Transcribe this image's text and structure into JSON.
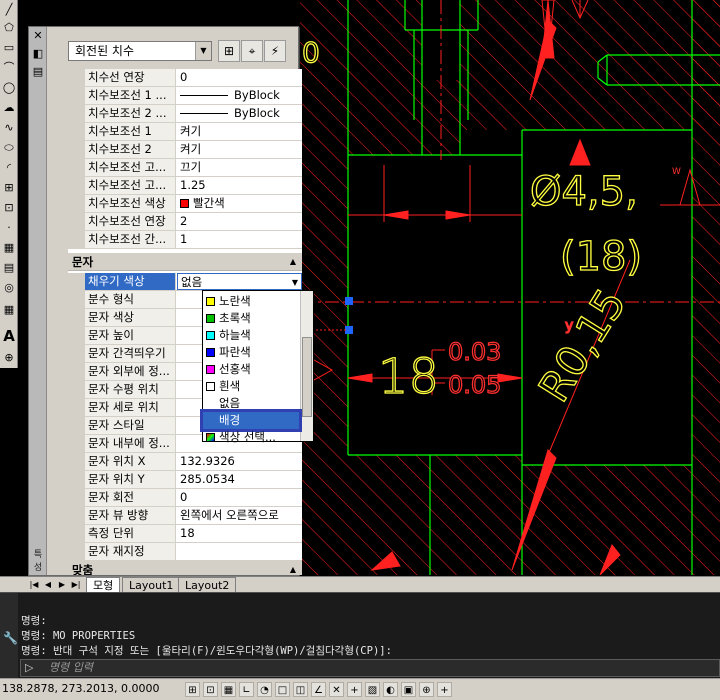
{
  "toolbar": {
    "icons": [
      "line-icon",
      "polygon-icon",
      "rectangle-icon",
      "arc-icon",
      "circle-icon",
      "revision-cloud-icon",
      "spline-icon",
      "ellipse-icon",
      "ellipse-arc-icon",
      "insert-block-icon",
      "make-block-icon",
      "point-icon",
      "hatch-icon",
      "gradient-icon",
      "region-icon",
      "table-icon",
      "mtext-icon"
    ],
    "mtext_glyph": "A"
  },
  "palette": {
    "object_type": "회전된 치수",
    "close_glyph": "✕",
    "buttons": [
      "toggle-pickadd-icon",
      "select-objects-icon",
      "quick-select-icon"
    ],
    "rows_top": [
      {
        "name": "치수선 연장",
        "value": "0"
      },
      {
        "name": "치수보조선 1 ...",
        "value": "ByBlock",
        "linetype": true
      },
      {
        "name": "치수보조선 2 ...",
        "value": "ByBlock",
        "linetype": true
      },
      {
        "name": "치수보조선 1",
        "value": "켜기"
      },
      {
        "name": "치수보조선 2",
        "value": "켜기"
      },
      {
        "name": "치수보조선 고...",
        "value": "끄기"
      },
      {
        "name": "치수보조선 고...",
        "value": "1.25"
      },
      {
        "name": "치수보조선 색상",
        "value": "빨간색",
        "swatch": "#ff0000"
      },
      {
        "name": "치수보조선 연장",
        "value": "2"
      },
      {
        "name": "치수보조선 간...",
        "value": "1"
      }
    ],
    "section_text": "문자",
    "rows_text": [
      {
        "name": "채우기 색상",
        "value": "없음",
        "active": true
      },
      {
        "name": "분수 형식",
        "value": ""
      },
      {
        "name": "문자 색상",
        "value": ""
      },
      {
        "name": "문자 높이",
        "value": ""
      },
      {
        "name": "문자 간격띄우기",
        "value": ""
      },
      {
        "name": "문자 외부에 정...",
        "value": ""
      },
      {
        "name": "문자 수평 위치",
        "value": ""
      },
      {
        "name": "문자 세로 위치",
        "value": ""
      },
      {
        "name": "문자 스타일",
        "value": ""
      },
      {
        "name": "문자 내부에 정...",
        "value": ""
      },
      {
        "name": "문자 위치 X",
        "value": "132.9326"
      },
      {
        "name": "문자 위치 Y",
        "value": "285.0534"
      },
      {
        "name": "문자 회전",
        "value": "0"
      },
      {
        "name": "문자 뷰 방향",
        "value": "왼쪽에서 오른쪽으로"
      },
      {
        "name": "측정 단위",
        "value": "18"
      },
      {
        "name": "문자 재지정",
        "value": ""
      }
    ],
    "section_last": "맞춤",
    "dropdown": [
      {
        "label": "노란색",
        "swatch": "#ffff00"
      },
      {
        "label": "초록색",
        "swatch": "#00c000"
      },
      {
        "label": "하늘색",
        "swatch": "#00ffff"
      },
      {
        "label": "파란색",
        "swatch": "#0000ff"
      },
      {
        "label": "선홍색",
        "swatch": "#ff00ff"
      },
      {
        "label": "흰색",
        "swatch": "#ffffff"
      },
      {
        "label": "없음",
        "swatch": ""
      },
      {
        "label": "배경",
        "swatch": "",
        "highlight": true
      },
      {
        "label": "색상 선택...",
        "swatch": "",
        "icon": true
      }
    ],
    "vertical_label": "특성"
  },
  "canvas": {
    "dim_main": "18",
    "tol_upper": "0.03",
    "tol_lower": "0.05",
    "dia_label": "Ø4,5,",
    "paren_label": "(18)",
    "radius_label": "R0,15",
    "small_zero": "0",
    "small_w": "W",
    "small_y": "y",
    "colors": {
      "background": "#000000",
      "geometry": "#00ff00",
      "dimension": "#ff0000",
      "text": "#ffff00",
      "grip": "#1e64ff"
    }
  },
  "tabs": {
    "items": [
      {
        "label": "모형",
        "active": true
      },
      {
        "label": "Layout1",
        "active": false
      },
      {
        "label": "Layout2",
        "active": false
      }
    ]
  },
  "command": {
    "lines": [
      "명령:",
      "명령: MO PROPERTIES",
      "명령: 반대 구석 지정 또는 [울타리(F)/윈도우다각형(WP)/걸침다각형(CP)]:"
    ],
    "prompt_glyph": "▷",
    "placeholder": "명령 입력"
  },
  "status": {
    "coords": "138.2878, 273.2013, 0.0000",
    "icons": [
      "infer-constraints-icon",
      "snap-mode-icon",
      "grid-display-icon",
      "ortho-mode-icon",
      "polar-tracking-icon",
      "object-snap-icon",
      "3d-osnap-icon",
      "object-snap-tracking-icon",
      "dynamic-ucs-icon",
      "dynamic-input-icon",
      "lineweight-icon",
      "transparency-icon",
      "quick-properties-icon",
      "selection-cycling-icon",
      "annotation-monitor-icon"
    ]
  }
}
